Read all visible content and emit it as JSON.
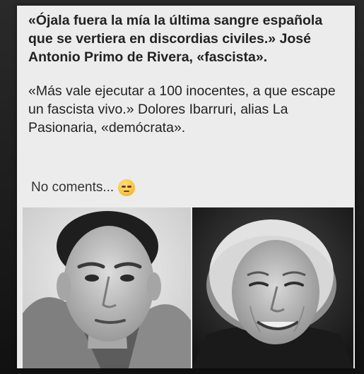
{
  "post": {
    "quote1": "«Ójala fuera la mía la última sangre española que se vertiera en discordias civiles.» José Antonio Primo de Rivera, «fascista».",
    "quote2": "«Más vale ejecutar a 100 inocentes, a que escape un fascista vivo.» Dolores Ibarruri, alias La Pasionaria, «demócrata».",
    "comment": "No coments...",
    "comment_emoji": "rolling-eyes-emoji"
  },
  "photos": [
    {
      "subject": "man-portrait",
      "tone": "grayscale"
    },
    {
      "subject": "elderly-woman-portrait",
      "tone": "grayscale"
    }
  ]
}
